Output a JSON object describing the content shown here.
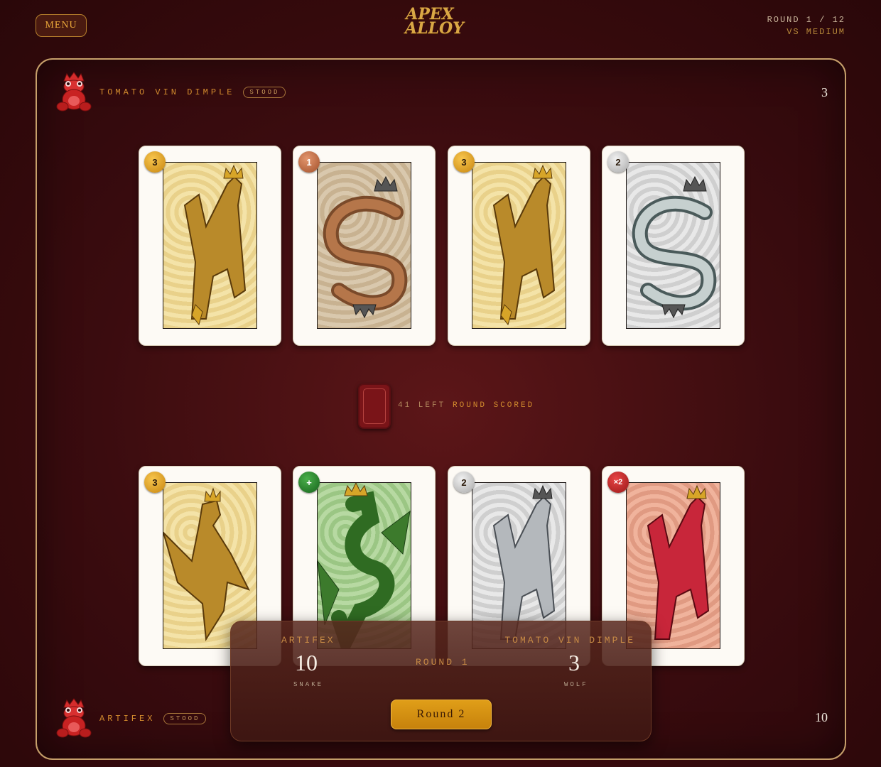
{
  "header": {
    "menu_label": "MENU",
    "logo_line1": "APEX",
    "logo_line2": "ALLOY",
    "round_text": "ROUND 1 / 12",
    "vs_text": "VS MEDIUM"
  },
  "opponent": {
    "name": "TOMATO VIN DIMPLE",
    "status": "STOOD",
    "score": "3",
    "cards": [
      {
        "badge": "3",
        "animal": "wolf",
        "metal": "gold"
      },
      {
        "badge": "1",
        "animal": "snake",
        "metal": "bronze"
      },
      {
        "badge": "3",
        "animal": "wolf",
        "metal": "gold"
      },
      {
        "badge": "2",
        "animal": "snake",
        "metal": "silver"
      }
    ]
  },
  "player": {
    "name": "ARTIFEX",
    "status": "STOOD",
    "score": "10",
    "cards": [
      {
        "badge": "3",
        "animal": "eagle",
        "metal": "gold"
      },
      {
        "badge": "+",
        "animal": "dragon",
        "metal": "green"
      },
      {
        "badge": "2",
        "animal": "wolf",
        "metal": "silver"
      },
      {
        "badge": "×2",
        "animal": "wolf",
        "metal": "red"
      }
    ]
  },
  "deck": {
    "left_text": "41 LEFT",
    "status_text": "ROUND SCORED"
  },
  "summary": {
    "left_name": "ARTIFEX",
    "left_score": "10",
    "left_animal": "SNAKE",
    "round_label": "ROUND 1",
    "right_name": "TOMATO VIN DIMPLE",
    "right_score": "3",
    "right_animal": "WOLF",
    "next_button": "Round 2"
  },
  "colors": {
    "accent": "#d38c2e",
    "board_border": "#c7a06b",
    "button": "#d9920f"
  }
}
